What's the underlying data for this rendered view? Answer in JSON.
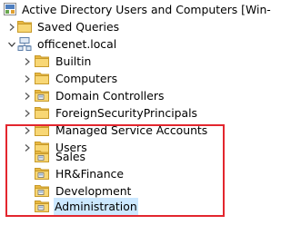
{
  "tree": {
    "root": {
      "label": "Active Directory Users and Computers [Win-",
      "icon": "ad-console-icon"
    },
    "saved_queries": {
      "label": "Saved Queries",
      "icon": "folder-icon"
    },
    "domain": {
      "label": "officenet.local",
      "icon": "domain-icon",
      "expanded": true
    },
    "children": [
      {
        "label": "Builtin",
        "icon": "folder-icon"
      },
      {
        "label": "Computers",
        "icon": "folder-icon"
      },
      {
        "label": "Domain Controllers",
        "icon": "ou-icon"
      },
      {
        "label": "ForeignSecurityPrincipals",
        "icon": "folder-icon"
      },
      {
        "label": "Managed Service Accounts",
        "icon": "folder-icon"
      },
      {
        "label": "Users",
        "icon": "folder-icon"
      },
      {
        "label": "Sales",
        "icon": "ou-icon"
      },
      {
        "label": "HR&Finance",
        "icon": "ou-icon"
      },
      {
        "label": "Development",
        "icon": "ou-icon"
      },
      {
        "label": "Administration",
        "icon": "ou-icon",
        "selected": true
      }
    ]
  },
  "colors": {
    "selection": "#cce8ff",
    "highlight_border": "#e3262e",
    "folder": "#f5c94a"
  }
}
